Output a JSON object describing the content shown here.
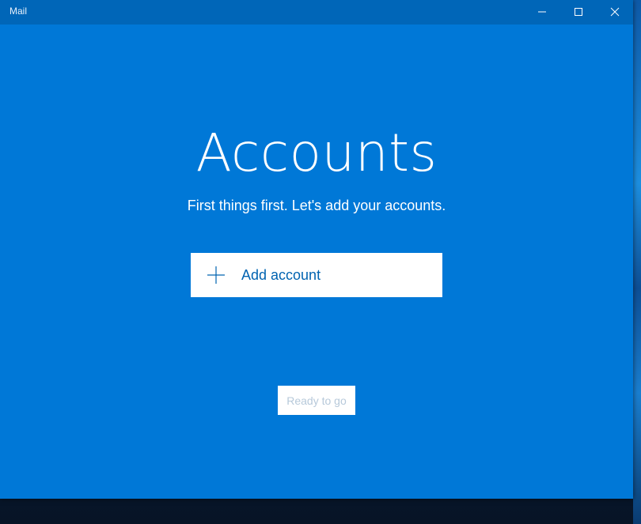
{
  "window": {
    "app_title": "Mail",
    "controls": {
      "minimize_icon": "minimize-icon",
      "maximize_icon": "maximize-icon",
      "close_icon": "close-icon"
    }
  },
  "main": {
    "heading": "Accounts",
    "subheading": "First things first. Let's add your accounts.",
    "add_account_label": "Add account",
    "add_account_icon": "plus-icon",
    "ready_button_label": "Ready to go"
  },
  "colors": {
    "accent": "#0078d7",
    "titlebar": "#0066b8",
    "button_text": "#0063b1"
  }
}
